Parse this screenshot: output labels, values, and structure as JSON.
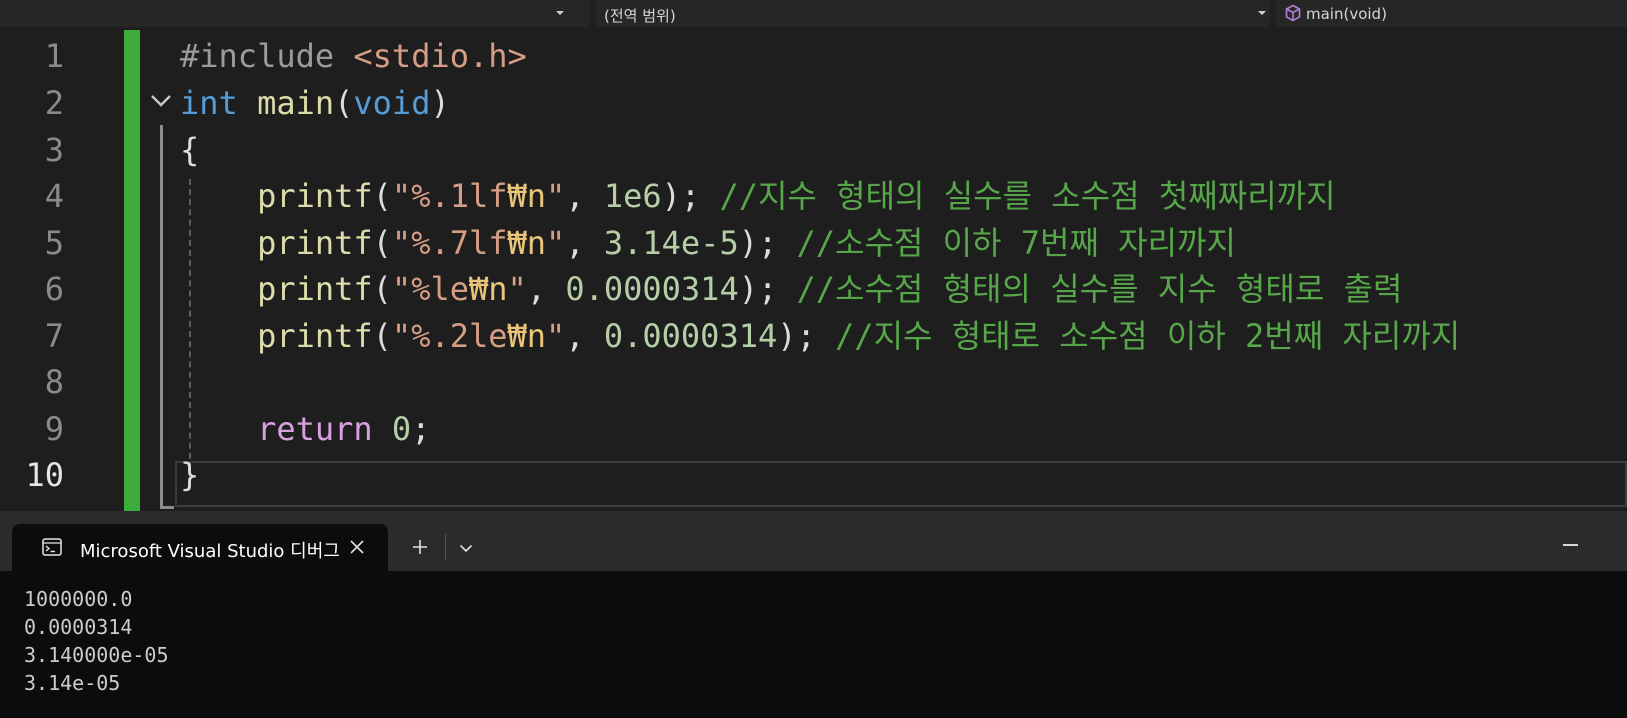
{
  "navbar": {
    "scope_label": "(전역 범위)",
    "function_label": "main(void)"
  },
  "editor": {
    "line_numbers": [
      "1",
      "2",
      "3",
      "4",
      "5",
      "6",
      "7",
      "8",
      "9",
      "10"
    ],
    "lines": {
      "l1": {
        "directive": "#include",
        "header": "<stdio.h>"
      },
      "l2": {
        "type": "int",
        "name": "main",
        "open": "(",
        "param": "void",
        "close": ")"
      },
      "l3": {
        "brace": "{"
      },
      "l4": {
        "fn": "printf",
        "open": "(",
        "q1": "\"",
        "fmt": "%.1lf",
        "esc": "₩n",
        "q2": "\"",
        "comma": ", ",
        "arg": "1e6",
        "end": ");",
        "comment": " //지수 형태의 실수를 소수점 첫째짜리까지"
      },
      "l5": {
        "fn": "printf",
        "open": "(",
        "q1": "\"",
        "fmt": "%.7lf",
        "esc": "₩n",
        "q2": "\"",
        "comma": ", ",
        "arg": "3.14e-5",
        "end": ");",
        "comment": " //소수점 이하 7번째 자리까지"
      },
      "l6": {
        "fn": "printf",
        "open": "(",
        "q1": "\"",
        "fmt": "%le",
        "esc": "₩n",
        "q2": "\"",
        "comma": ", ",
        "arg": "0.0000314",
        "end": ");",
        "comment": " //소수점 형태의 실수를 지수 형태로 출력"
      },
      "l7": {
        "fn": "printf",
        "open": "(",
        "q1": "\"",
        "fmt": "%.2le",
        "esc": "₩n",
        "q2": "\"",
        "comma": ", ",
        "arg": "0.0000314",
        "end": ");",
        "comment": " //지수 형태로 소수점 이하 2번째 자리까지"
      },
      "l9": {
        "kw": "return",
        "arg": "0",
        "end": ";"
      },
      "l10": {
        "brace": "}"
      }
    }
  },
  "terminal": {
    "tab_title": "Microsoft Visual Studio 디버그",
    "output": [
      "1000000.0",
      "0.0000314",
      "3.140000e-05",
      "3.14e-05"
    ]
  }
}
